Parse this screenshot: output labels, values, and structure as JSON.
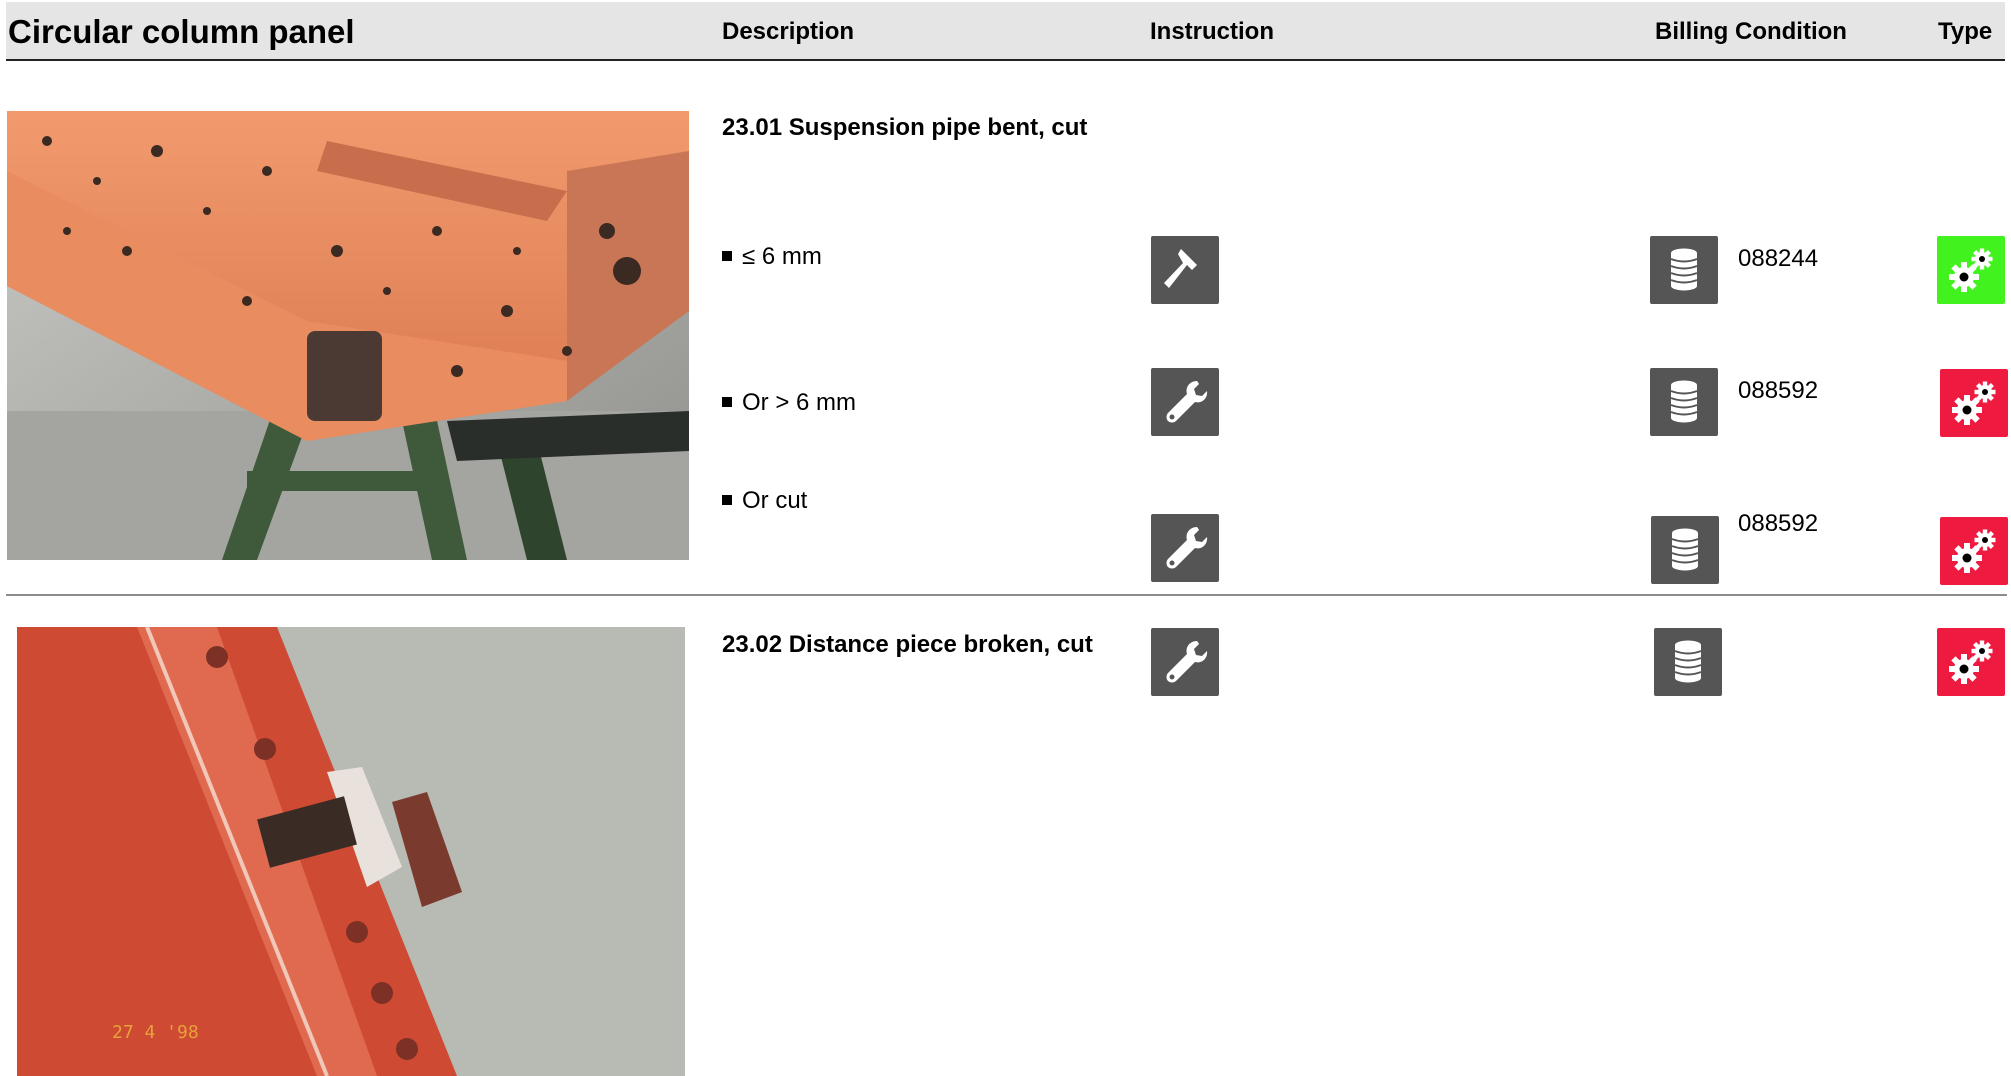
{
  "header": {
    "title": "Circular column panel",
    "description": "Description",
    "instruction": "Instruction",
    "billing_condition": "Billing Condition",
    "type": "Type"
  },
  "sections": [
    {
      "heading": "23.01 Suspension pipe bent, cut",
      "image_icon": "photo-bent-suspension-pipe",
      "rows": [
        {
          "label": "≤ 6 mm",
          "instruction_icon": "hammer-icon",
          "billing_icon": "coins-icon",
          "billing_code": "088244",
          "type_icon": "gears-icon",
          "type_color": "#42f21f"
        },
        {
          "label": "Or > 6 mm",
          "instruction_icon": "wrench-icon",
          "billing_icon": "coins-icon",
          "billing_code": "088592",
          "type_icon": "gears-icon",
          "type_color": "#ee1a40"
        },
        {
          "label": "Or cut",
          "instruction_icon": "wrench-icon",
          "billing_icon": "coins-icon",
          "billing_code": "088592",
          "type_icon": "gears-icon",
          "type_color": "#ee1a40"
        }
      ]
    },
    {
      "heading": "23.02 Distance piece broken, cut",
      "image_icon": "photo-broken-distance-piece",
      "photo_stamp": "27  4 '98",
      "rows": [
        {
          "instruction_icon": "wrench-icon",
          "billing_icon": "coins-icon",
          "type_icon": "gears-icon",
          "type_color": "#ee1a40"
        }
      ]
    }
  ]
}
